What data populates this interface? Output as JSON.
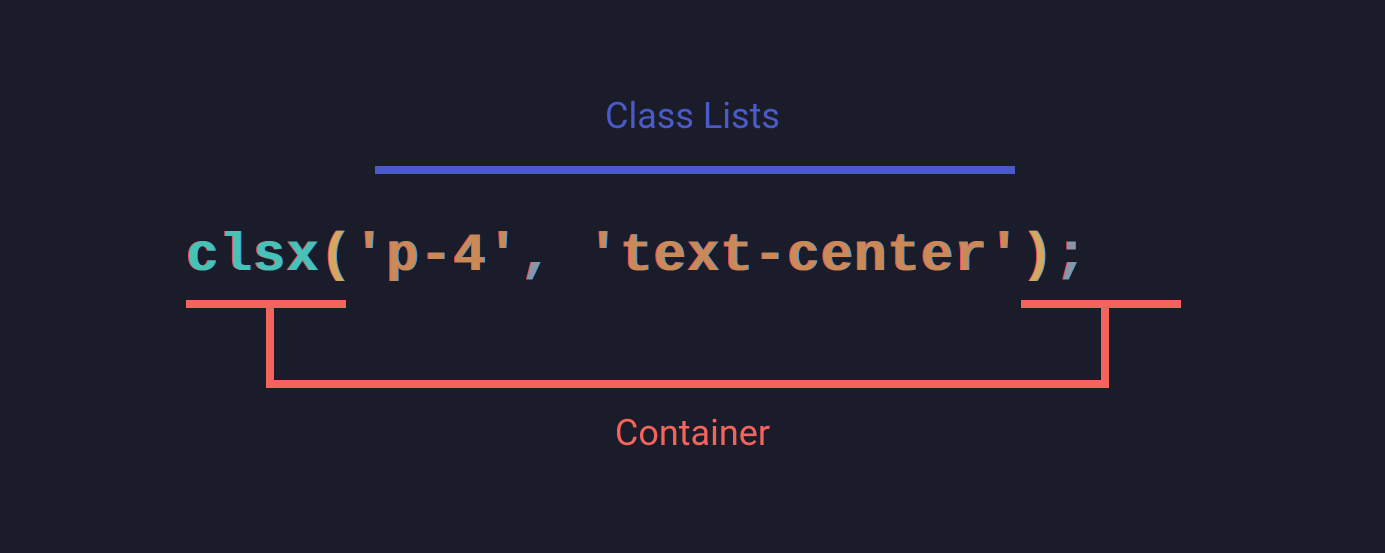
{
  "labels": {
    "top": "Class Lists",
    "bottom": "Container"
  },
  "code": {
    "function_name": "clsx",
    "open_paren": "(",
    "arg1": "'p-4'",
    "comma": ",",
    "space": " ",
    "arg2": "'text-center'",
    "close_paren": ")",
    "semicolon": ";"
  },
  "colors": {
    "background": "#1a1d29",
    "label_top": "#4a5ac9",
    "label_bottom": "#f5645c",
    "bracket_top": "#4a5ac9",
    "bracket_bottom": "#f5645c",
    "token_function": "#47c3b6",
    "token_paren": "#d4a85e",
    "token_string": "#c98a58",
    "token_punct": "#8a95a8"
  }
}
